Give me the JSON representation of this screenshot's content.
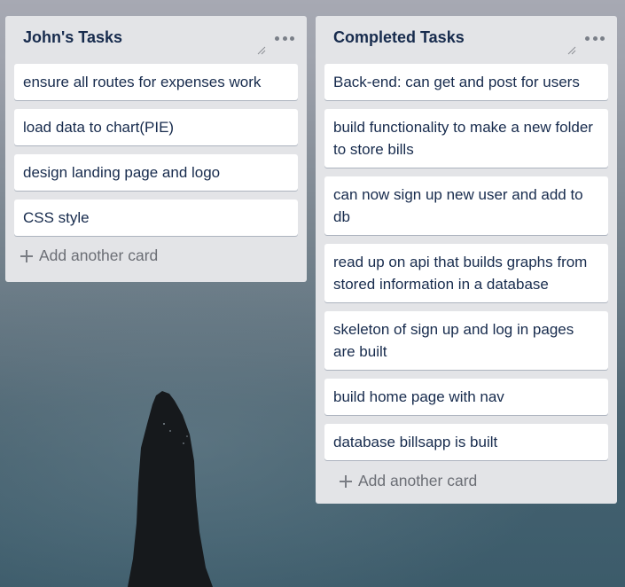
{
  "board": {
    "lists": [
      {
        "title": "John's Tasks",
        "cards": [
          "ensure all routes for expenses work",
          "load data to chart(PIE)",
          "design landing page and logo",
          "CSS style"
        ],
        "add_card_label": "Add another card"
      },
      {
        "title": "Completed Tasks",
        "cards": [
          "Back-end: can get and post for users",
          "build functionality to make a new folder to store bills",
          "can now sign up new user and add to db",
          "read up on api that builds graphs from stored information in a database",
          "skeleton of sign up and log in pages are built",
          "build home page with nav",
          "database billsapp is built"
        ],
        "add_card_label": "Add another card"
      }
    ]
  },
  "icons": {
    "list_menu": "more-horizontal-icon",
    "resize": "resize-handle-icon",
    "add": "plus-icon"
  },
  "colors": {
    "list_background": "#e3e4e7",
    "card_background": "#ffffff",
    "card_text": "#172b4d",
    "muted_text": "#6b6e75"
  }
}
